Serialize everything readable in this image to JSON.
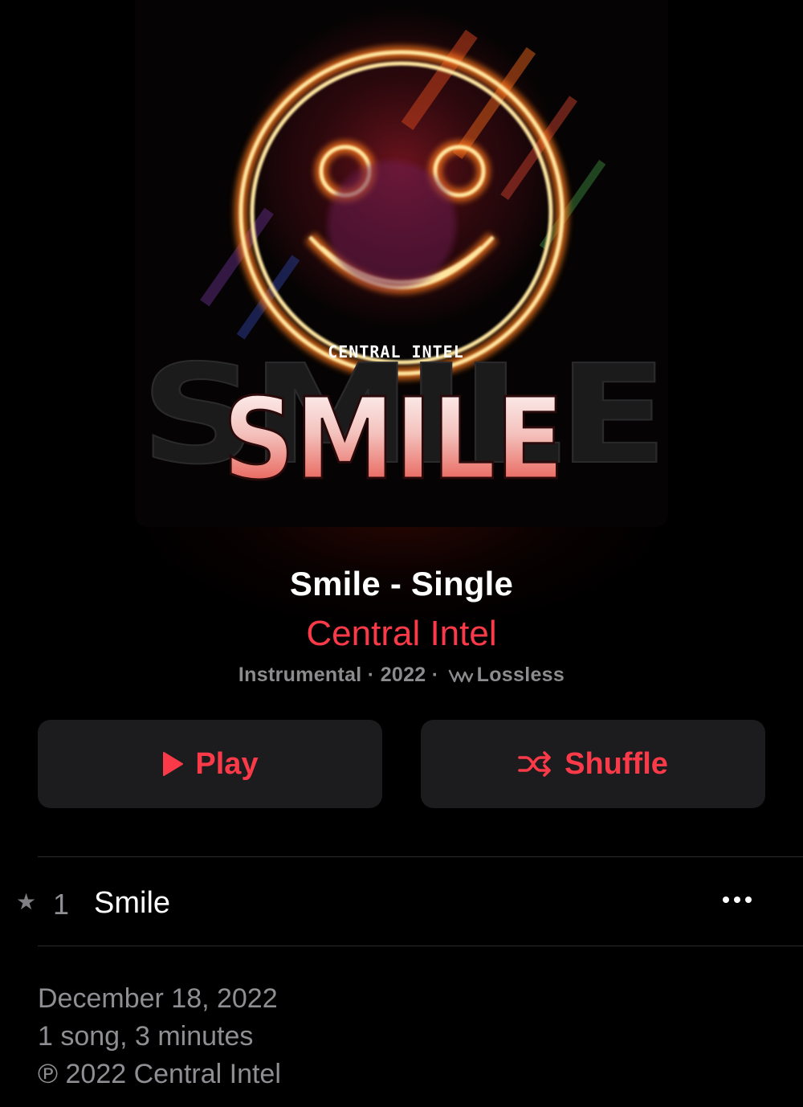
{
  "album": {
    "artwork": {
      "label": "CENTRAL INTEL",
      "word": "SMILE"
    },
    "title": "Smile - Single",
    "artist": "Central Intel",
    "genre": "Instrumental",
    "year": "2022",
    "quality": "Lossless",
    "separator": "·"
  },
  "actions": {
    "play_label": "Play",
    "shuffle_label": "Shuffle"
  },
  "tracks": [
    {
      "number": "1",
      "title": "Smile",
      "popular_icon": "star-icon"
    }
  ],
  "footer": {
    "release_date": "December 18, 2022",
    "summary": "1 song, 3 minutes",
    "copyright": "℗ 2022 Central Intel"
  },
  "colors": {
    "accent": "#fa3a48",
    "background": "#000000",
    "button_bg": "#1c1c1e",
    "secondary_text": "#8e8e93"
  },
  "icons": [
    "play-icon",
    "shuffle-icon",
    "lossless-icon",
    "star-icon",
    "more-icon"
  ]
}
